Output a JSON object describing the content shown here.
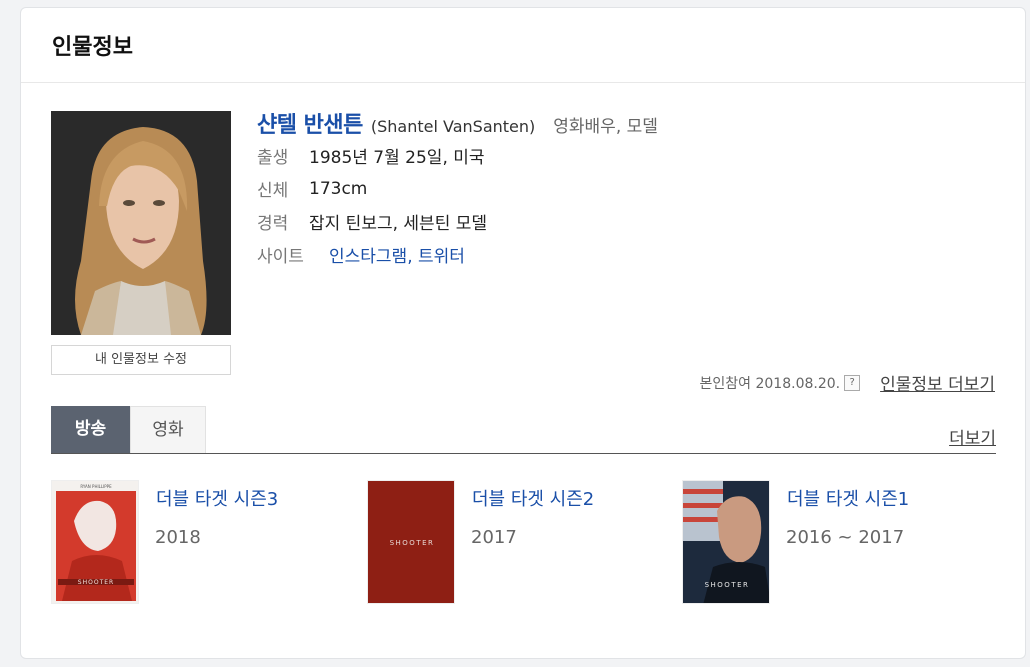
{
  "header": {
    "title": "인물정보"
  },
  "person": {
    "name_ko": "샨텔 반샌튼",
    "name_en": "(Shantel VanSanten)",
    "job": "영화배우, 모델",
    "rows": [
      {
        "label": "출생",
        "value": "1985년 7월 25일, 미국"
      },
      {
        "label": "신체",
        "value": "173cm"
      },
      {
        "label": "경력",
        "value": "잡지 틴보그, 세븐틴 모델"
      }
    ],
    "site_label": "사이트",
    "sites": [
      "인스타그램",
      "트위터"
    ],
    "edit_button": "내 인물정보 수정"
  },
  "meta": {
    "participation": "본인참여 2018.08.20.",
    "help": "?",
    "more_info": "인물정보 더보기"
  },
  "tabs": {
    "items": [
      "방송",
      "영화"
    ],
    "active": "방송",
    "more": "더보기"
  },
  "shows": [
    {
      "title": "더블 타겟 시즌3",
      "year": "2018",
      "poster_text": "SHOOTER",
      "poster_top": "RYAN PHILLIPPE"
    },
    {
      "title": "더블 타겟 시즌2",
      "year": "2017",
      "poster_text": "SHOOTER"
    },
    {
      "title": "더블 타겟 시즌1",
      "year": "2016 ~ 2017",
      "poster_text": "SHOOTER"
    }
  ],
  "colors": {
    "accent": "#1a4fa8",
    "active_tab": "#5b6370",
    "poster_red": "#8e1f14"
  }
}
